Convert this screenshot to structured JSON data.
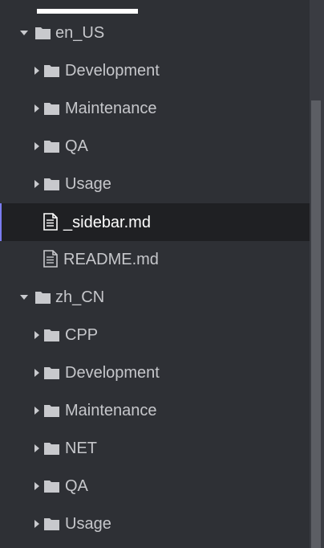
{
  "explorer": {
    "items": [
      {
        "label": "en_US",
        "type": "folder",
        "expanded": true
      },
      {
        "label": "Development",
        "type": "folder",
        "expanded": false
      },
      {
        "label": "Maintenance",
        "type": "folder",
        "expanded": false
      },
      {
        "label": "QA",
        "type": "folder",
        "expanded": false
      },
      {
        "label": "Usage",
        "type": "folder",
        "expanded": false
      },
      {
        "label": "_sidebar.md",
        "type": "file",
        "selected": true
      },
      {
        "label": "README.md",
        "type": "file"
      },
      {
        "label": "zh_CN",
        "type": "folder",
        "expanded": true
      },
      {
        "label": "CPP",
        "type": "folder",
        "expanded": false
      },
      {
        "label": "Development",
        "type": "folder",
        "expanded": false
      },
      {
        "label": "Maintenance",
        "type": "folder",
        "expanded": false
      },
      {
        "label": "NET",
        "type": "folder",
        "expanded": false
      },
      {
        "label": "QA",
        "type": "folder",
        "expanded": false
      },
      {
        "label": "Usage",
        "type": "folder",
        "expanded": false
      }
    ]
  },
  "colors": {
    "background": "#2e3035",
    "selected_row": "#1f2023",
    "text": "#c6c7cb",
    "icon": "#c8c9cd",
    "selected_accent": "#7a7cf0"
  },
  "icons": {
    "folder": "folder-icon",
    "file": "file-text-icon",
    "collapsed": "chevron-right-icon",
    "expanded": "chevron-down-icon"
  }
}
